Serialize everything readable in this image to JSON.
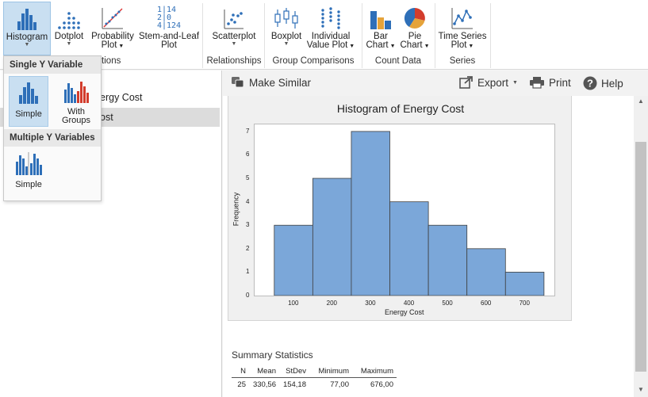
{
  "ribbon": {
    "buttons": {
      "histogram": "Histogram",
      "dotplot": "Dotplot",
      "probability_plot": [
        "Probability",
        "Plot"
      ],
      "stem_and_leaf": [
        "Stem-and-Leaf",
        "Plot"
      ],
      "scatterplot": "Scatterplot",
      "boxplot": "Boxplot",
      "individual_value_plot": [
        "Individual",
        "Value Plot"
      ],
      "bar_chart": [
        "Bar",
        "Chart"
      ],
      "pie_chart": [
        "Pie",
        "Chart"
      ],
      "time_series_plot": [
        "Time Series",
        "Plot"
      ]
    },
    "stem_icon_lines": [
      "1|14",
      "2|0",
      "4|124"
    ],
    "groups": {
      "distributions_partial": "utions",
      "relationships": "Relationships",
      "group_comparisons": "Group Comparisons",
      "count_data": "Count Data",
      "series": "Series"
    }
  },
  "dropdown": {
    "single_header": "Single Y Variable",
    "simple": "Simple",
    "with_groups": [
      "With",
      "Groups"
    ],
    "multiple_header": "Multiple Y Variables",
    "multiple_simple": "Simple"
  },
  "left_pane": {
    "items": [
      "ergy Cost",
      "ost"
    ]
  },
  "toolbar": {
    "make_similar": "Make Similar",
    "export": "Export",
    "print": "Print",
    "help": "Help"
  },
  "chart_data": {
    "type": "bar",
    "title": "Histogram of Energy Cost",
    "xlabel": "Energy Cost",
    "ylabel": "Frequency",
    "bins": [
      {
        "from": 50,
        "to": 150,
        "count": 3
      },
      {
        "from": 150,
        "to": 250,
        "count": 5
      },
      {
        "from": 250,
        "to": 350,
        "count": 7
      },
      {
        "from": 350,
        "to": 450,
        "count": 4
      },
      {
        "from": 450,
        "to": 550,
        "count": 3
      },
      {
        "from": 550,
        "to": 650,
        "count": 2
      },
      {
        "from": 650,
        "to": 750,
        "count": 1
      }
    ],
    "xticks": [
      100,
      200,
      300,
      400,
      500,
      600,
      700
    ],
    "yticks": [
      0,
      1,
      2,
      3,
      4,
      5,
      6,
      7
    ],
    "xlim": [
      -1,
      777
    ],
    "ylim": [
      0,
      7.3
    ],
    "bar_color": "#7ba7d9",
    "bar_edge_color": "#404040",
    "grid": false
  },
  "summary": {
    "title": "Summary Statistics",
    "columns": [
      "N",
      "Mean",
      "StDev",
      "Minimum",
      "Maximum"
    ],
    "row": [
      "25",
      "330,56",
      "154,18",
      "77,00",
      "676,00"
    ]
  }
}
